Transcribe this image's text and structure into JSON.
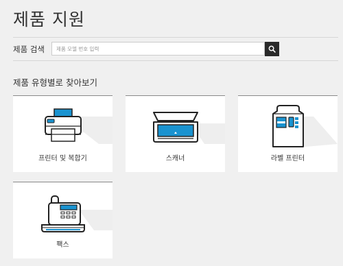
{
  "page": {
    "title": "제품 지원"
  },
  "search": {
    "label": "제품 검색",
    "placeholder": "제품 모델 번호 입력",
    "button_icon": "search-icon"
  },
  "categories": {
    "title": "제품 유형별로 찾아보기",
    "items": [
      {
        "label": "프린터 및 복합기",
        "icon": "printer-icon"
      },
      {
        "label": "스캐너",
        "icon": "scanner-icon"
      },
      {
        "label": "라벨 프린터",
        "icon": "label-printer-icon"
      },
      {
        "label": "팩스",
        "icon": "fax-icon"
      }
    ]
  },
  "colors": {
    "accent": "#1a93d0",
    "background": "#f0f0f0",
    "dark": "#2a2a2a"
  }
}
